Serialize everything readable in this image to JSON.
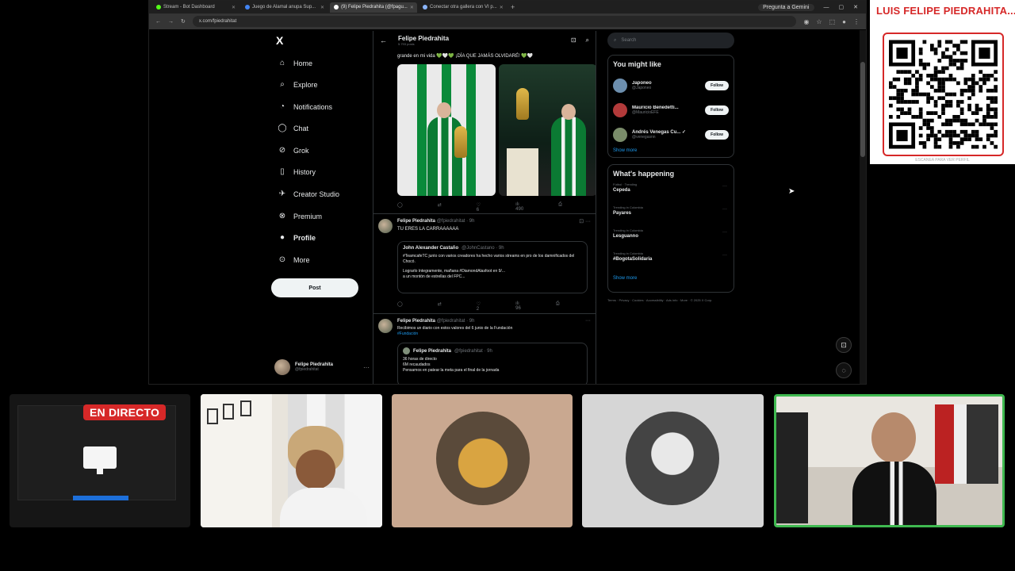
{
  "browser": {
    "tabs": [
      {
        "label": "Stream - Bot Dashboard",
        "color": "#53fc18",
        "active": false
      },
      {
        "label": "Juego de Alamal anupa Sup...",
        "color": "#4285f4",
        "active": false
      },
      {
        "label": "(9) Felipe Piedrahita (@fpagu...",
        "color": "#ffffff",
        "active": true
      },
      {
        "label": "Conectar otra gallera con VI p...",
        "color": "#8ab4f8",
        "active": false
      }
    ],
    "new_tab": "+",
    "window_pill": "Pregunta a Gemini",
    "url": "x.com/fpiedrahitat"
  },
  "xnav": {
    "logo": "X",
    "items": [
      {
        "label": "Home",
        "icon": "⌂"
      },
      {
        "label": "Explore",
        "icon": "⌕"
      },
      {
        "label": "Notifications",
        "icon": "🔔"
      },
      {
        "label": "Chat",
        "icon": "◯"
      },
      {
        "label": "Grok",
        "icon": "⊘"
      },
      {
        "label": "History",
        "icon": "▯"
      },
      {
        "label": "Creator Studio",
        "icon": "✈"
      },
      {
        "label": "Premium",
        "icon": "⊗"
      },
      {
        "label": "Profile",
        "icon": "👤"
      },
      {
        "label": "More",
        "icon": "⋯"
      }
    ],
    "post_label": "Post",
    "account_name": "Felipe Piedrahita",
    "account_handle": "@fpiedrahitat",
    "account_more": "···"
  },
  "feed": {
    "header_name": "Felipe Piedrahita",
    "header_sub": "5.793 posts",
    "top_text": "grande en mi vida 💚🤍💚 ¡DÍA QUE JAMÁS OLVIDARÉ! 💚🤍",
    "top_actions": [
      "◯",
      "⇄",
      "♡ 6",
      "ılı 490",
      "⎙",
      "⇪"
    ],
    "tweet2": {
      "name": "Felipe Piedrahita",
      "handle": "@fpiedrahitat · 9h",
      "text": "TU ERES LA CARRAAAAAA",
      "quote_name": "John Alexander Castaño",
      "quote_handle": "@JohnCastano · 9h",
      "quote_text1": "#TeamcafeTC junto con varios creadores ha hecho varios streams en pro de los damnificados del Chocó.",
      "quote_text2": "Lograrlo íntegramente, mañana #DiamondAlasfoot en 9/...",
      "quote_text3": "a un montón de estrellas del FPC...",
      "actions": [
        "◯",
        "⇄",
        "♡ 2",
        "ılı 96",
        "⎙",
        "⇪"
      ]
    },
    "tweet3": {
      "name": "Felipe Piedrahita",
      "handle": "@fpiedrahitat · 9h",
      "text": "Recibimos un diario con estos valores del 6 junio de la Fundación",
      "text_link": "#Fundación",
      "quote_name": "Felipe Piedrahita",
      "quote_handle": "@fpiedrahitat · 9h",
      "quote_line1": "36 horas de directo",
      "quote_line2": "6M recaudados",
      "quote_line3": "Pensamos en patear la meta para el final de la jornada"
    }
  },
  "sidebar": {
    "search_placeholder": "Search",
    "wtf_title": "You might like",
    "wtf": [
      {
        "name": "Japoneo",
        "handle": "@Japoneo",
        "btn": "Follow",
        "color": "#6d8fae"
      },
      {
        "name": "Mauricio Benedetti...",
        "handle": "@MauricioEFE",
        "btn": "Follow",
        "color": "#b23a3a"
      },
      {
        "name": "Andrés Venegas Cu... ✓",
        "handle": "@venegasnn",
        "btn": "Follow",
        "color": "#7a8c6a"
      }
    ],
    "show_more": "Show more",
    "happening_title": "What's happening",
    "trends": [
      {
        "context": "Fútbol · Trending",
        "name": "Cepeda"
      },
      {
        "context": "Trending in Colombia",
        "name": "Payares"
      },
      {
        "context": "Trending in Colombia",
        "name": "Lesguanno"
      },
      {
        "context": "Trending in Colombia",
        "name": "#BogotaSolidaria"
      }
    ],
    "trend_more": "···",
    "show_more2": "Show more",
    "footer": "Terms · Privacy · Cookies · Accessibility · Ads info · More · © 2025 X Corp."
  },
  "stream": {
    "qr_title": "LUIS FELIPE PIEDRAHITA...",
    "qr_caption": "ESCANEA PARA VER PERFIL",
    "live_label": "EN DIRECTO"
  }
}
